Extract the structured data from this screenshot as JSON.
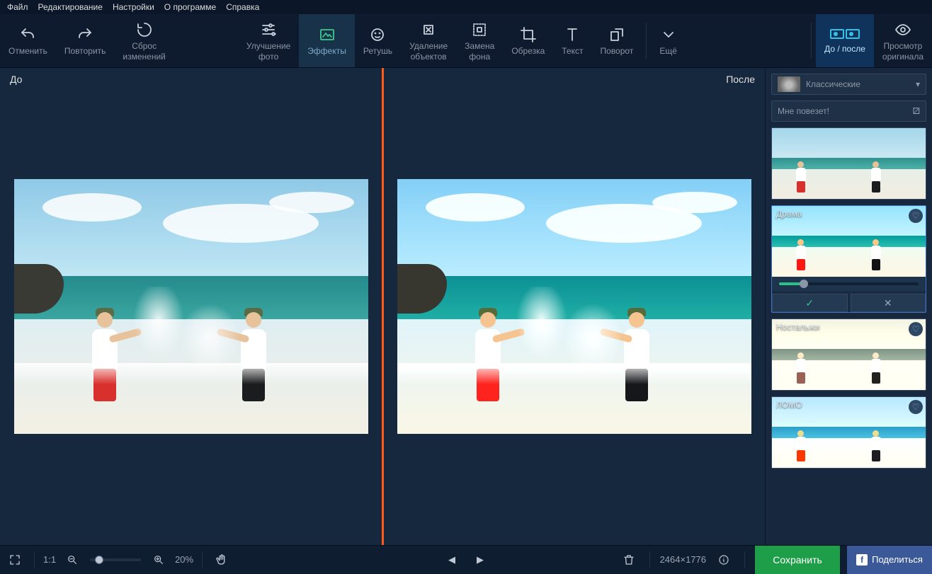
{
  "menu": {
    "file": "Файл",
    "edit": "Редактирование",
    "settings": "Настройки",
    "about": "О программе",
    "help": "Справка"
  },
  "toolbar": {
    "undo": "Отменить",
    "redo": "Повторить",
    "reset": "Сброс\nизменений",
    "enhance": "Улучшение\nфото",
    "effects": "Эффекты",
    "retouch": "Ретушь",
    "removeObjects": "Удаление\nобъектов",
    "replaceBg": "Замена\nфона",
    "crop": "Обрезка",
    "text": "Текст",
    "rotate": "Поворот",
    "more": "Ещё",
    "beforeAfter": "До / после",
    "viewOriginal": "Просмотр\nоригинала"
  },
  "compare": {
    "before": "До",
    "after": "После"
  },
  "panel": {
    "category": "Классические",
    "lucky": "Мне повезет!",
    "effects": [
      {
        "name": ""
      },
      {
        "name": "Драма"
      },
      {
        "name": "Ностальжи"
      },
      {
        "name": "ЛОМО"
      }
    ]
  },
  "bottom": {
    "oneToOne": "1:1",
    "zoom": "20%",
    "dimensions": "2464×1776",
    "save": "Сохранить",
    "share": "Поделиться"
  }
}
